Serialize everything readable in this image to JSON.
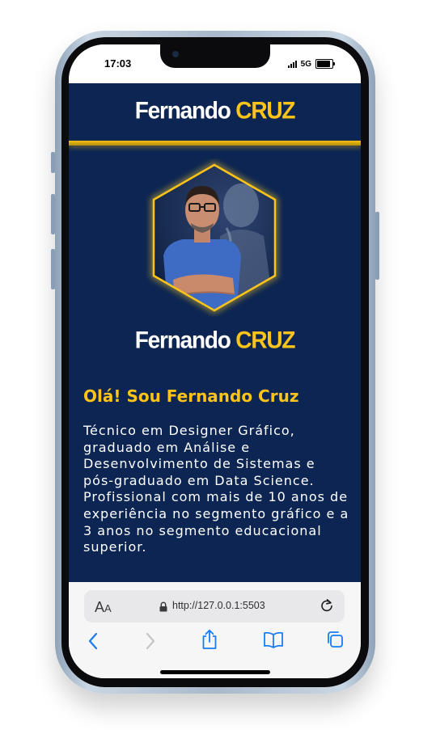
{
  "status": {
    "time": "17:03",
    "network": "5G",
    "battery_level": 0.9
  },
  "site": {
    "brand_first": "Fernando",
    "brand_last": "CRUZ",
    "greeting": "Olá! Sou Fernando Cruz",
    "bio": "Técnico em Designer Gráfico, graduado em Análise e Desenvolvimento de Sistemas e pós-graduado em Data Science. Profissional com mais de 10 anos de experiência no segmento gráfico e a 3 anos no segmento educacional superior."
  },
  "browser": {
    "aa_big": "A",
    "aa_small": "A",
    "url": "http://127.0.0.1:5503"
  },
  "icons": {
    "lock": "lock-icon",
    "reload": "reload-icon",
    "back": "back-icon",
    "forward": "forward-icon",
    "share": "share-icon",
    "bookmarks": "bookmarks-icon",
    "tabs": "tabs-icon"
  },
  "colors": {
    "brand_navy": "#0c2552",
    "accent_gold": "#fcc419",
    "ios_blue": "#1a7cf5"
  }
}
